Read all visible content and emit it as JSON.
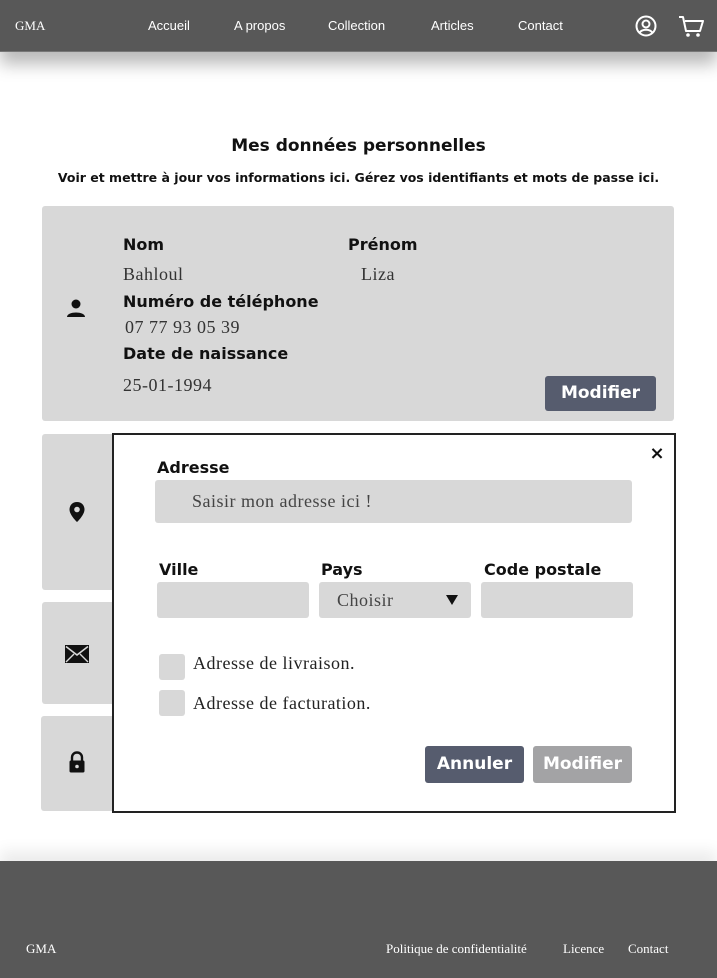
{
  "header": {
    "brand": "GMA",
    "nav": [
      "Accueil",
      "A propos",
      "Collection",
      "Articles",
      "Contact"
    ],
    "icons": [
      "user-circle-icon",
      "cart-icon"
    ]
  },
  "page": {
    "title": "Mes données personnelles",
    "subtitle": "Voir et mettre à jour vos informations ici. Gérez vos identifiants et mots de passe ici."
  },
  "personal": {
    "nom_label": "Nom",
    "nom_value": "Bahloul",
    "prenom_label": "Prénom",
    "prenom_value": "Liza",
    "phone_label": "Numéro de téléphone",
    "phone_value": "07 77 93 05 39",
    "birth_label": "Date de naissance",
    "birth_value": "25-01-1994",
    "modify_label": "Modifier"
  },
  "modal": {
    "address_label": "Adresse",
    "address_placeholder": "Saisir mon adresse ici !",
    "city_label": "Ville",
    "country_label": "Pays",
    "country_value": "Choisir",
    "postal_label": "Code postale",
    "delivery_label": "Adresse de livraison.",
    "billing_label": "Adresse de facturation.",
    "cancel_label": "Annuler",
    "modify_label": "Modifier",
    "close_symbol": "×"
  },
  "footer": {
    "brand": "GMA",
    "links": [
      "Politique de confidentialité",
      "Licence",
      "Contact"
    ]
  },
  "colors": {
    "header_bg": "#585858",
    "card_bg": "#d8d8d8",
    "primary_button": "#565c6e",
    "secondary_button": "#a3a3a5"
  }
}
